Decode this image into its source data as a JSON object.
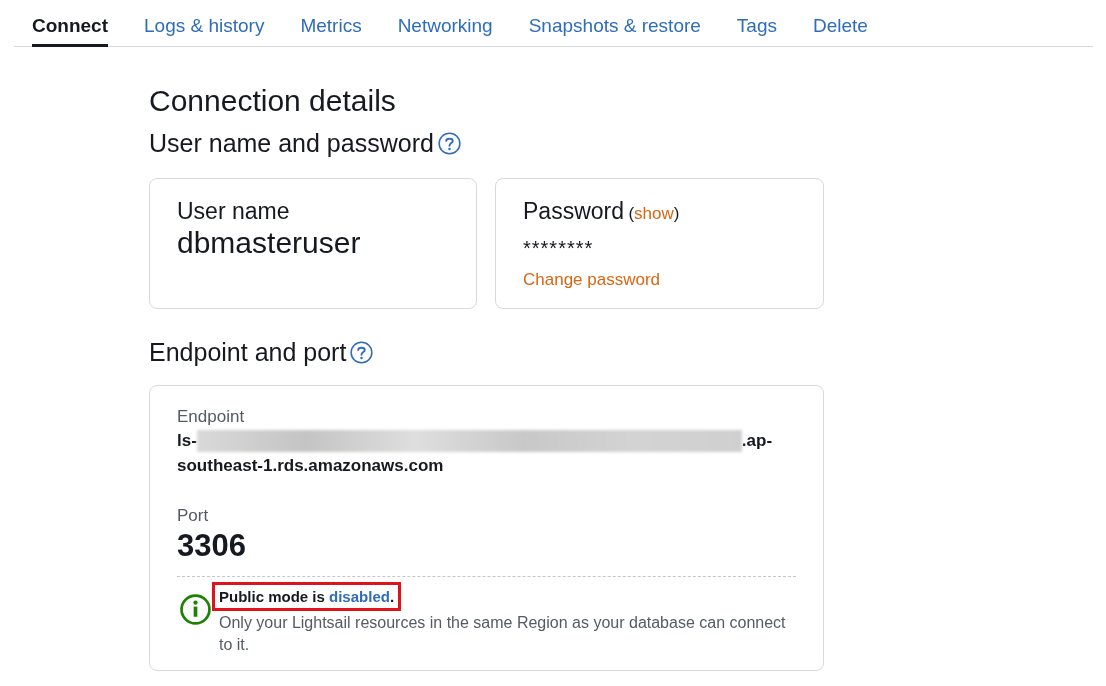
{
  "tabs": [
    {
      "label": "Connect",
      "selected": true
    },
    {
      "label": "Logs & history",
      "selected": false
    },
    {
      "label": "Metrics",
      "selected": false
    },
    {
      "label": "Networking",
      "selected": false
    },
    {
      "label": "Snapshots & restore",
      "selected": false
    },
    {
      "label": "Tags",
      "selected": false
    },
    {
      "label": "Delete",
      "selected": false
    }
  ],
  "title": "Connection details",
  "credentials": {
    "heading": "User name and password",
    "user_name": {
      "label": "User name",
      "value": "dbmasteruser"
    },
    "password": {
      "label": "Password",
      "paren_open": "(",
      "show_link": "show",
      "paren_close": ")",
      "masked_value": "********",
      "change_link": "Change password"
    }
  },
  "endpoint_section": {
    "heading": "Endpoint and port",
    "endpoint": {
      "label": "Endpoint",
      "lines": [
        {
          "parts": [
            {
              "kind": "text",
              "text": "ls-"
            },
            {
              "kind": "redacted"
            },
            {
              "kind": "text",
              "text": ".ap-"
            }
          ]
        },
        {
          "parts": [
            {
              "kind": "text",
              "text": "southeast-1.rds.amazonaws.com"
            }
          ]
        }
      ]
    },
    "port": {
      "label": "Port",
      "value": "3306"
    },
    "notice": {
      "highlighted": true,
      "title_before": "Public mode is ",
      "title_link": "disabled",
      "title_after": ".",
      "description": "Only your Lightsail resources in the same Region as your database can connect to it."
    }
  }
}
